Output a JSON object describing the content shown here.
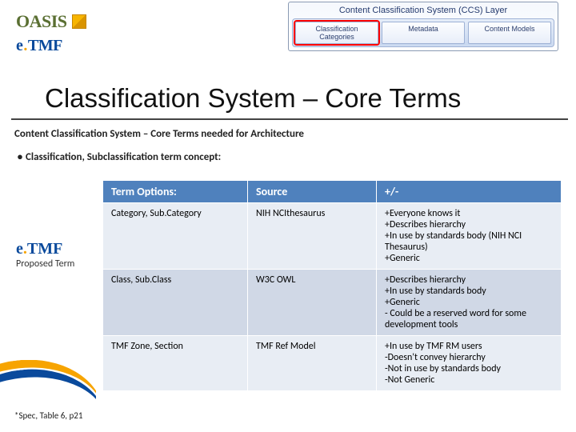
{
  "brand": {
    "oasis_text": "OASIS",
    "etmf_e": "e",
    "etmf_dot": ".",
    "etmf_tmf": "TMF"
  },
  "layer_diagram": {
    "title": "Content Classification System (CCS) Layer",
    "boxes": [
      {
        "label": "Classification Categories",
        "highlighted": true
      },
      {
        "label": "Metadata",
        "highlighted": false
      },
      {
        "label": "Content Models",
        "highlighted": false
      }
    ]
  },
  "title": "Classification System – Core Terms",
  "subtitle": "Content Classification System – Core Terms needed for Architecture",
  "bullet": "Classification, Subclassification term concept:",
  "proposed_term_label": "Proposed Term",
  "table": {
    "headers": [
      "Term Options:",
      "Source",
      "+/-"
    ],
    "rows": [
      {
        "term": "Category, Sub.Category",
        "source": "NIH NCIthesaurus",
        "pros": "+Everyone knows it\n+Describes hierarchy\n+In use by standards body (NIH NCI Thesaurus)\n+Generic"
      },
      {
        "term": "Class, Sub.Class",
        "source": "W3C OWL",
        "pros": "+Describes hierarchy\n+In use by standards body\n+Generic\n- Could be a reserved word for some development tools"
      },
      {
        "term": "TMF Zone, Section",
        "source": "TMF Ref Model",
        "pros": "+In use by TMF RM users\n-Doesn't convey hierarchy\n-Not in use by standards body\n-Not Generic"
      }
    ]
  },
  "footnote": "*Spec, Table 6, p21"
}
